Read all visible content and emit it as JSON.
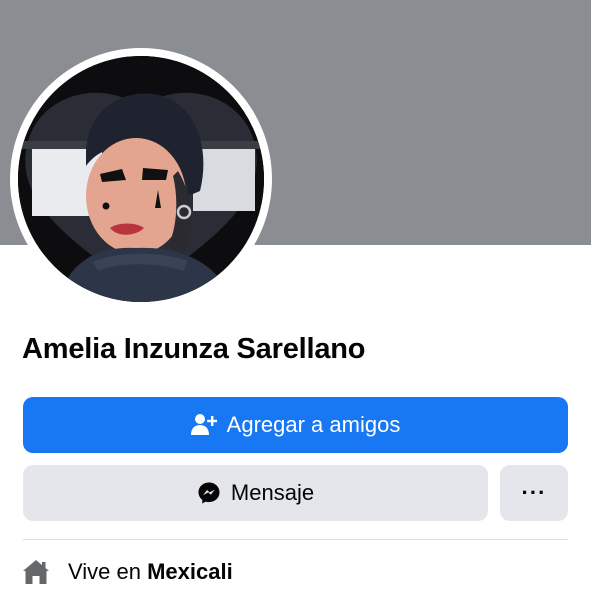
{
  "profile": {
    "name": "Amelia Inzunza Sarellano",
    "avatar_icon": "profile-photo"
  },
  "actions": {
    "add_friend_label": "Agregar a amigos",
    "add_friend_icon": "add-friend-icon",
    "message_label": "Mensaje",
    "message_icon": "messenger-icon",
    "more_label": "···"
  },
  "intro": {
    "lives_in_prefix": "Vive en",
    "lives_in_city": "Mexicali",
    "icon": "home-icon"
  },
  "colors": {
    "cover": "#8a8d91",
    "primary_button": "#1877f2",
    "secondary_button": "#e4e6eb",
    "text": "#050505"
  }
}
